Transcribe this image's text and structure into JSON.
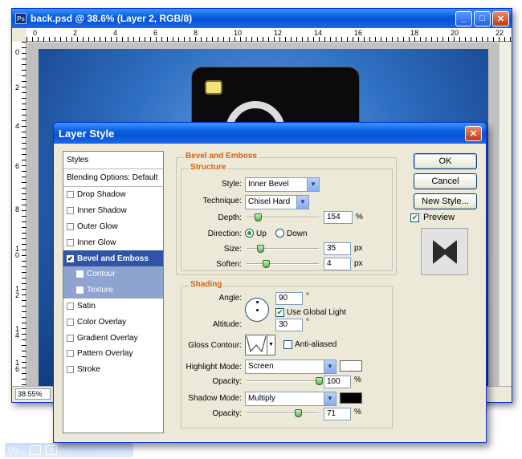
{
  "document": {
    "title": "back.psd @ 38.6% (Layer 2, RGB/8)",
    "zoom": "38.55%",
    "ruler_top": [
      "0",
      "2",
      "4",
      "6",
      "8",
      "10",
      "12",
      "14",
      "16",
      "18",
      "20",
      "22"
    ],
    "ruler_left": [
      "0",
      "2",
      "4",
      "6",
      "8",
      "1 0",
      "1 2",
      "1 4",
      "1 6",
      "1 8"
    ]
  },
  "taskbar": {
    "minimized_label": "Un..."
  },
  "dialog": {
    "title": "Layer Style",
    "styles_list": {
      "header": "Styles",
      "blending": "Blending Options: Default",
      "items": [
        {
          "label": "Drop Shadow",
          "checked": false
        },
        {
          "label": "Inner Shadow",
          "checked": false
        },
        {
          "label": "Outer Glow",
          "checked": false
        },
        {
          "label": "Inner Glow",
          "checked": false
        },
        {
          "label": "Bevel and Emboss",
          "checked": true,
          "selected": true
        },
        {
          "label": "Contour",
          "checked": false,
          "sub": true
        },
        {
          "label": "Texture",
          "checked": false,
          "sub": true
        },
        {
          "label": "Satin",
          "checked": false
        },
        {
          "label": "Color Overlay",
          "checked": false
        },
        {
          "label": "Gradient Overlay",
          "checked": false
        },
        {
          "label": "Pattern Overlay",
          "checked": false
        },
        {
          "label": "Stroke",
          "checked": false
        }
      ]
    },
    "bevel": {
      "section_title": "Bevel and Emboss",
      "structure_title": "Structure",
      "style_label": "Style:",
      "style_value": "Inner Bevel",
      "technique_label": "Technique:",
      "technique_value": "Chisel Hard",
      "depth_label": "Depth:",
      "depth_value": "154",
      "depth_unit": "%",
      "direction_label": "Direction:",
      "direction_up": "Up",
      "direction_down": "Down",
      "size_label": "Size:",
      "size_value": "35",
      "size_unit": "px",
      "soften_label": "Soften:",
      "soften_value": "4",
      "soften_unit": "px"
    },
    "shading": {
      "title": "Shading",
      "angle_label": "Angle:",
      "angle_value": "90",
      "angle_unit": "°",
      "global_light": "Use Global Light",
      "altitude_label": "Altitude:",
      "altitude_value": "30",
      "altitude_unit": "°",
      "gloss_label": "Gloss Contour:",
      "anti_aliased": "Anti-aliased",
      "highlight_mode_label": "Highlight Mode:",
      "highlight_mode_value": "Screen",
      "highlight_color": "#ffffff",
      "highlight_opacity_label": "Opacity:",
      "highlight_opacity_value": "100",
      "highlight_opacity_unit": "%",
      "shadow_mode_label": "Shadow Mode:",
      "shadow_mode_value": "Multiply",
      "shadow_color": "#000000",
      "shadow_opacity_label": "Opacity:",
      "shadow_opacity_value": "71",
      "shadow_opacity_unit": "%"
    },
    "buttons": {
      "ok": "OK",
      "cancel": "Cancel",
      "new_style": "New Style...",
      "preview": "Preview"
    }
  }
}
